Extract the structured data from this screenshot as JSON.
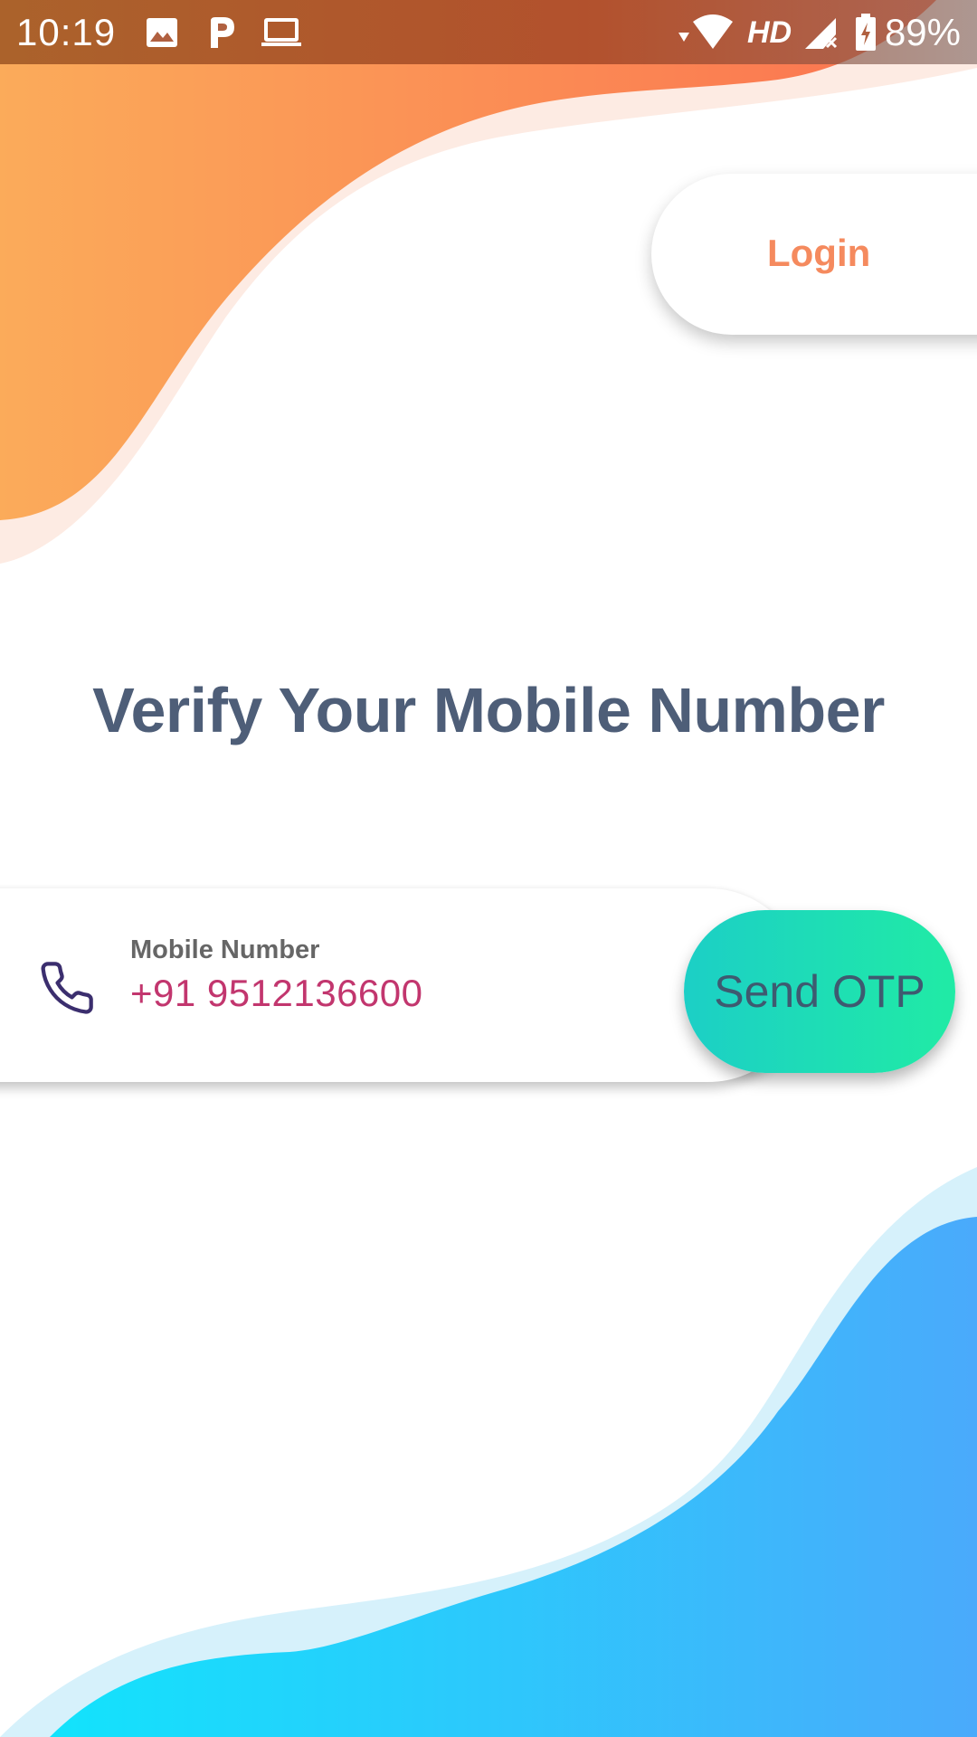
{
  "status_bar": {
    "time": "10:19",
    "network_type": "HD",
    "battery_percent": "89%",
    "icons": [
      "image-icon",
      "p-icon",
      "laptop-icon",
      "wifi-icon",
      "signal-off-icon",
      "battery-charging-icon"
    ]
  },
  "header": {
    "login_label": "Login"
  },
  "main": {
    "title": "Verify Your Mobile Number",
    "phone_field": {
      "label": "Mobile Number",
      "value": "+91 9512136600",
      "icon": "phone-icon"
    },
    "send_otp_label": "Send OTP"
  },
  "colors": {
    "orange_wave_start": "#FBAB5A",
    "orange_wave_end": "#FB7350",
    "blue_wave_start": "#12E3FC",
    "blue_wave_end": "#4AAAFB",
    "title": "#4E5E78",
    "login_text": "#F58A5E",
    "phone_value": "#C2366E",
    "otp_gradient_start": "#1CCFC6",
    "otp_gradient_end": "#20EBA5"
  }
}
